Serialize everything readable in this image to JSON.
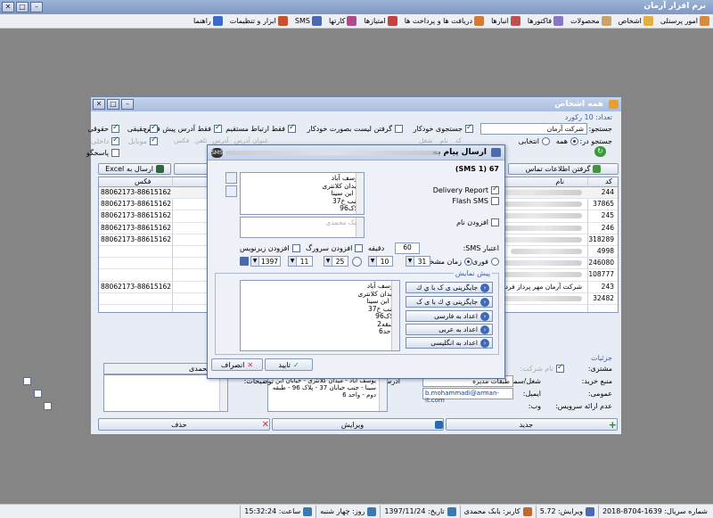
{
  "app": {
    "title": "نرم افزار آرمان"
  },
  "menu": [
    {
      "label": "امور پرسنلی"
    },
    {
      "label": "اشخاص"
    },
    {
      "label": "محصولات"
    },
    {
      "label": "فاکتورها"
    },
    {
      "label": "انبارها"
    },
    {
      "label": "دریافت ها و پرداخت ها"
    },
    {
      "label": "امتیازها"
    },
    {
      "label": "کارتها"
    },
    {
      "label": "SMS"
    },
    {
      "label": "ابزار و تنظیمات"
    },
    {
      "label": "راهنما"
    }
  ],
  "form": {
    "title": "همه اشخاص",
    "count": "تعداد: 10 رکورد",
    "search_label": "جستجو:",
    "search_value": "شرکت آرمان",
    "auto_search": "جستجوی خودکار",
    "auto_list": "گرفتن لیست بصورت خودکار",
    "search_in": "جستجو در:",
    "all": "همه",
    "selective": "انتخابی",
    "code": "کد",
    "name": "نام",
    "job": "شغل",
    "address_title": "عنوان آدرس",
    "address": "آدرس",
    "phone": "تلفن",
    "fax": "فکس",
    "mobile": "موبایل",
    "internal": "داخلی",
    "legal": "حقوقی",
    "natural": "حقیقی",
    "default_addr_only": "فقط آدرس پیش فرض",
    "direct_only": "فقط ارتباط مستقیم",
    "answering": "پاسخگو",
    "get_info": "گرفتن اطلاعات تماس",
    "send_excel": "ارسال به Excel",
    "col_code": "کد",
    "col_name": "نام",
    "col_fax": "فکس",
    "rows": [
      {
        "code": "244",
        "fax": "88062173-88615162"
      },
      {
        "code": "37865",
        "fax": "88062173-88615162"
      },
      {
        "code": "245",
        "fax": "88062173-88615162"
      },
      {
        "code": "246",
        "fax": "88062173-88615162"
      },
      {
        "code": "318289",
        "fax": "88062173-88615162"
      },
      {
        "code": "4998",
        "fax": ""
      },
      {
        "code": "246080",
        "fax": ""
      },
      {
        "code": "108777",
        "fax": ""
      },
      {
        "code": "243",
        "fax": "88062173-88615162",
        "name": "شرکت آرمان مهر پرداز فردا (پ"
      },
      {
        "code": "32482",
        "fax": ""
      }
    ],
    "details": "جزئیات",
    "customer": "مشتری:",
    "company_name": "نام شرکت:",
    "buy_source": "منبع خرید:",
    "job_position": "شغل/سمت:",
    "job_value": "طبقات مدیره",
    "general": "عمومی:",
    "email": "ایمیل:",
    "email_value": "b.mohammadi@arman-it.com",
    "no_service": "عدم ارائه سرویس:",
    "web": "وب:",
    "address_lbl": "آدرس:",
    "address_value": "یوسف آباد - میدان کلانتری - خیابان ابن سینا - جنب خیابان 37 - پلاک 96 - طبقه دوم - واحد 6",
    "notes": "توضیحات:",
    "person_name": "محمدی",
    "new": "جدید",
    "edit": "ویرایش",
    "delete": "حذف"
  },
  "dialog": {
    "title": "ارسال پیام به",
    "sms_count": "67 (1 SMS)",
    "delivery": "Delivery Report",
    "flash": "Flash SMS",
    "add_name": "افزودن نام",
    "message": "یوسف آباد\nمیدان کلانتری\nخ ابن سینا\nجنب خ37\nپلاک96",
    "signature": "بابک محمدی",
    "validity": "اعتبار SMS:",
    "validity_value": "60",
    "minute": "دقیقه",
    "add_header": "افزودن سرورگ",
    "add_footer": "افزودن زیرنویس",
    "immediate": "فوری",
    "scheduled": "زمان مشخص",
    "hour": "31",
    "min": "10",
    "day": "25",
    "month": "11",
    "year": "1397",
    "preview": "پیش نمایش",
    "preview_text": "یوسف آباد\nمیدان کلانتری\nخ ابن سینا\nجنب خ37\nپلاک96\nطبقه2\nواحد6",
    "btn_replace1": "جایگزینی ی ک با ي ك",
    "btn_replace2": "جایگزینی ي ك با ی ک",
    "btn_fa": "اعداد به فارسی",
    "btn_ar": "اعداد به عربی",
    "btn_en": "اعداد به انگلیسی",
    "ok": "تایید",
    "cancel": "انصراف"
  },
  "status": {
    "serial": "شماره سریال: 1639-8704-2018",
    "version": "ویرایش: 5.72",
    "user": "کاربر: بابک محمدی",
    "date": "تاریخ: 1397/11/24",
    "day": "روز: چهار شنبه",
    "time": "ساعت: 15:32:24"
  }
}
